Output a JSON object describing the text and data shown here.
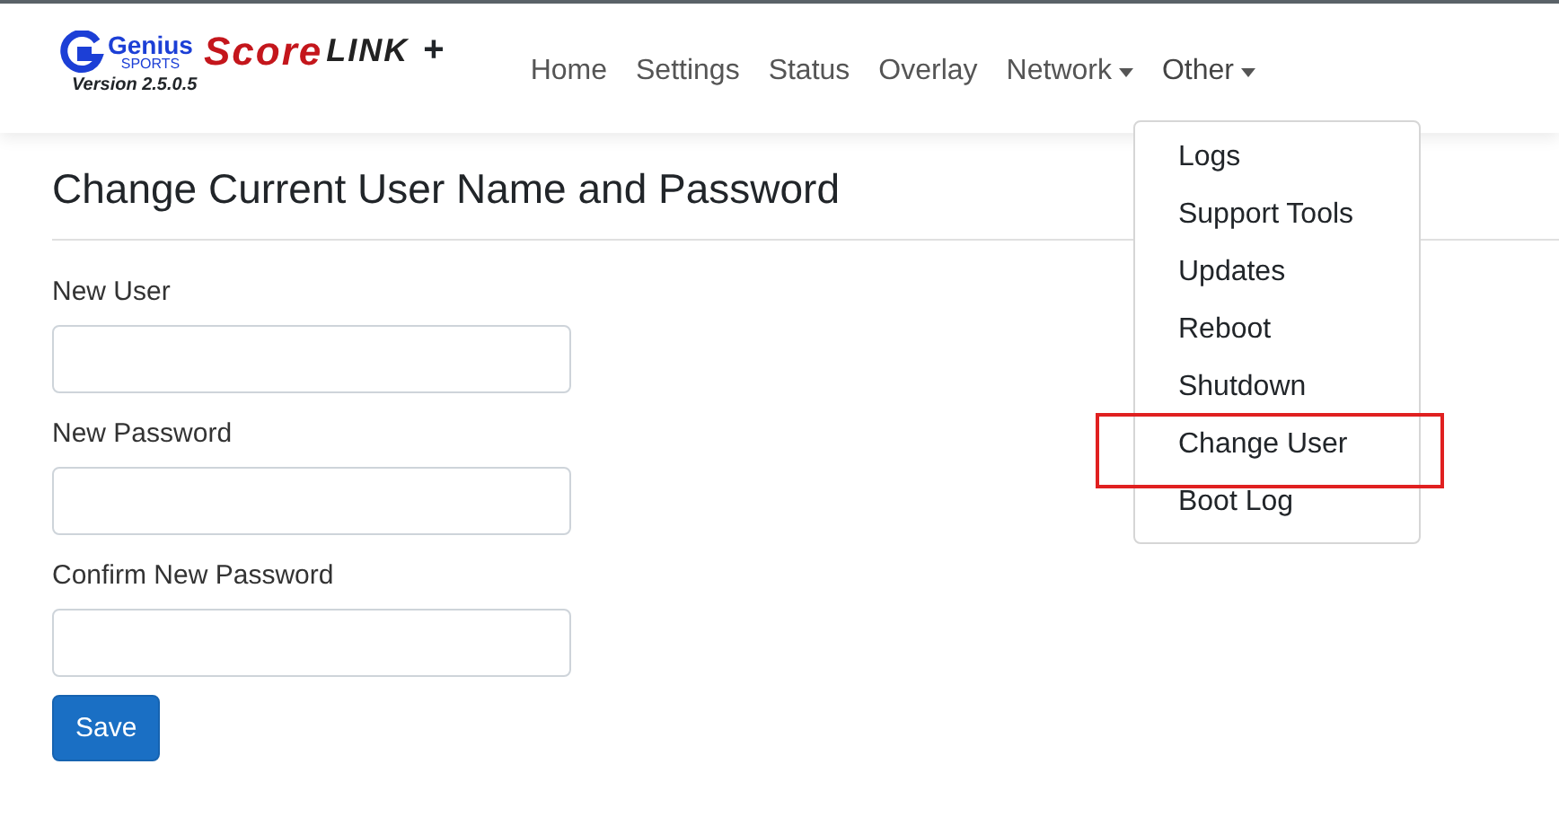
{
  "brand": {
    "company": "Genius",
    "company_sub": "SPORTS",
    "product_a": "Score",
    "product_b": "LINK",
    "product_plus": "+",
    "version": "Version 2.5.0.5"
  },
  "nav": [
    {
      "label": "Home",
      "dropdown": false,
      "expanded": false
    },
    {
      "label": "Settings",
      "dropdown": false,
      "expanded": false
    },
    {
      "label": "Status",
      "dropdown": false,
      "expanded": false
    },
    {
      "label": "Overlay",
      "dropdown": false,
      "expanded": false
    },
    {
      "label": "Network",
      "dropdown": true,
      "expanded": false
    },
    {
      "label": "Other",
      "dropdown": true,
      "expanded": true
    }
  ],
  "menu": [
    {
      "label": "Logs",
      "highlighted": false
    },
    {
      "label": "Support Tools",
      "highlighted": false
    },
    {
      "label": "Updates",
      "highlighted": false
    },
    {
      "label": "Reboot",
      "highlighted": false
    },
    {
      "label": "Shutdown",
      "highlighted": false
    },
    {
      "label": "Change User",
      "highlighted": true
    },
    {
      "label": "Boot Log",
      "highlighted": false
    }
  ],
  "heading": "Change Current User Name and Password",
  "fields": [
    {
      "label": "New User"
    },
    {
      "label": "New Password"
    },
    {
      "label": "Confirm New Password"
    }
  ],
  "save_button": "Save"
}
